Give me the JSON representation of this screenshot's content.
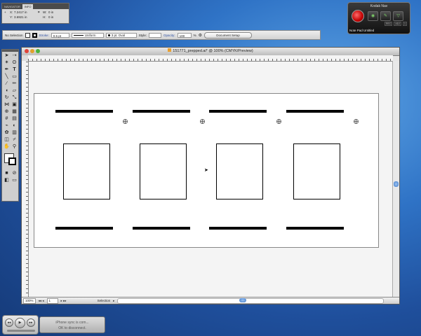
{
  "info_palette": {
    "tabs": [
      "NAVIGATOR",
      "INFO"
    ],
    "x_label": "X:",
    "x_value": "7.2417 in",
    "y_label": "Y:",
    "y_value": "3.6921 in",
    "w_label": "W:",
    "w_value": "0 in",
    "h_label": "H:",
    "h_value": "0 in"
  },
  "control_bar": {
    "selection_label": "No Selection",
    "stroke_label": "Stroke:",
    "stroke_weight": "0.5 pt",
    "profile": "Uniform",
    "brush": "3 pt. Oval",
    "style_label": "Style:",
    "opacity_label": "Opacity:",
    "opacity_value": "100",
    "opacity_unit": "%",
    "document_setup": "Document Setup"
  },
  "kodak_widget": {
    "title": "Kodak Nav",
    "status": "Note Pad Untitled",
    "mini_labels": [
      "REC",
      "ADJ",
      "1"
    ]
  },
  "document": {
    "title": "151771_prepped.ai* @ 100% (CMYK/Preview)",
    "zoom": "100%",
    "artboard": "1",
    "status_tool": "Selection"
  },
  "notification": {
    "line1": "iPhone sync is com...",
    "line2": "OK to disconnect."
  },
  "colors": {
    "desktop": "#2f73c6",
    "accent": "#3b78c8",
    "alert_red": "#c20000"
  }
}
